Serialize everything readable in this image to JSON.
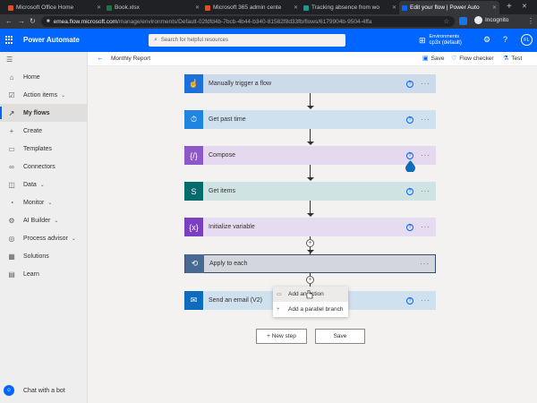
{
  "browser": {
    "tabs": [
      {
        "title": "Microsoft Office Home",
        "favicon_color": "#e74c1f"
      },
      {
        "title": "Book.xlsx",
        "favicon_color": "#1f7244"
      },
      {
        "title": "Microsoft 365 admin cente",
        "favicon_color": "#e74c1f"
      },
      {
        "title": "Tracking absence from wo",
        "favicon_color": "#1a9a8c"
      },
      {
        "title": "Edit your flow | Power Auto",
        "favicon_color": "#0066ff"
      }
    ],
    "new_tab_label": "+",
    "url_host": "emea.flow.microsoft.com",
    "url_path": "/manage/environments/Default-02fdfd4b-7bcb-4b44-b340-81582f8d33fb/flows/6179904b-9504-4ffa",
    "incognito_label": "Incognito"
  },
  "app": {
    "title": "Power Automate",
    "search_placeholder": "Search for helpful resources",
    "environment_label": "Environments",
    "environment_name": "cp3x (default)",
    "avatar_initials": "FL"
  },
  "sidebar": {
    "items": [
      {
        "label": "Home",
        "icon": "home-icon",
        "glyph": "⌂",
        "chevron": false,
        "active": false
      },
      {
        "label": "Action items",
        "icon": "checklist-icon",
        "glyph": "☑",
        "chevron": true,
        "active": false
      },
      {
        "label": "My flows",
        "icon": "flow-icon",
        "glyph": "↗",
        "chevron": false,
        "active": true
      },
      {
        "label": "Create",
        "icon": "plus-icon",
        "glyph": "+",
        "chevron": false,
        "active": false
      },
      {
        "label": "Templates",
        "icon": "templates-icon",
        "glyph": "▭",
        "chevron": false,
        "active": false
      },
      {
        "label": "Connectors",
        "icon": "connectors-icon",
        "glyph": "∞",
        "chevron": false,
        "active": false
      },
      {
        "label": "Data",
        "icon": "database-icon",
        "glyph": "◫",
        "chevron": true,
        "active": false
      },
      {
        "label": "Monitor",
        "icon": "monitor-icon",
        "glyph": "◔",
        "chevron": true,
        "active": false
      },
      {
        "label": "AI Builder",
        "icon": "ai-builder-icon",
        "glyph": "⚙",
        "chevron": true,
        "active": false
      },
      {
        "label": "Process advisor",
        "icon": "process-advisor-icon",
        "glyph": "◎",
        "chevron": true,
        "active": false
      },
      {
        "label": "Solutions",
        "icon": "solutions-icon",
        "glyph": "▦",
        "chevron": false,
        "active": false
      },
      {
        "label": "Learn",
        "icon": "book-icon",
        "glyph": "▤",
        "chevron": false,
        "active": false
      }
    ],
    "chatbot_label": "Chat with a bot"
  },
  "commandbar": {
    "flow_name": "Monthly Report",
    "save_label": "Save",
    "checker_label": "Flow checker",
    "test_label": "Test"
  },
  "flow": {
    "steps": [
      {
        "label": "Manually trigger a flow",
        "icon": "hand-tap-icon",
        "glyph": "☝"
      },
      {
        "label": "Get past time",
        "icon": "clock-icon",
        "glyph": "⏱"
      },
      {
        "label": "Compose",
        "icon": "compose-icon",
        "glyph": "{/}"
      },
      {
        "label": "Get items",
        "icon": "sharepoint-icon",
        "glyph": "S"
      },
      {
        "label": "Initialize variable",
        "icon": "variable-icon",
        "glyph": "{x}"
      },
      {
        "label": "Apply to each",
        "icon": "loop-icon",
        "glyph": "⟲"
      },
      {
        "label": "Send an email (V2)",
        "icon": "outlook-icon",
        "glyph": "✉"
      }
    ],
    "help_glyph": "?",
    "more_glyph": "···",
    "insert_menu": [
      {
        "label": "Add an action",
        "icon": "add-action-icon"
      },
      {
        "label": "Add a parallel branch",
        "icon": "parallel-branch-icon"
      }
    ],
    "new_step_label": "+ New step",
    "save_button_label": "Save"
  },
  "colors": {
    "brand": "#0066ff",
    "header_bg": "#0066ff",
    "canvas_bg": "#f3f2f1"
  }
}
